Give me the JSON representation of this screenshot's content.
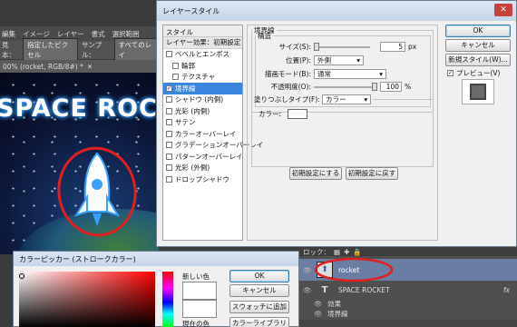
{
  "ps": {
    "menu": [
      "編集",
      "イメージ",
      "レイヤー",
      "書式",
      "選択範囲"
    ],
    "options": {
      "sample_label": "サンプル：",
      "sample_value": "指定したピクセル",
      "sample2_value": "すべてのレイ",
      "label0": "見本："
    },
    "doc_tab": "00% (rocket, RGB/8#) *",
    "canvas_title": "SPACE ROCK"
  },
  "layer_style": {
    "title": "レイヤースタイル",
    "close": "✕",
    "list_header": "スタイル",
    "list_subheader": "レイヤー効果：初期設定",
    "items": [
      {
        "label": "ベベルとエンボス",
        "checked": false,
        "sub": false,
        "selected": false
      },
      {
        "label": "輪郭",
        "checked": false,
        "sub": true,
        "selected": false
      },
      {
        "label": "テクスチャ",
        "checked": false,
        "sub": true,
        "selected": false
      },
      {
        "label": "境界線",
        "checked": true,
        "sub": false,
        "selected": true
      },
      {
        "label": "シャドウ (内側)",
        "checked": false,
        "sub": false,
        "selected": false
      },
      {
        "label": "光彩 (内側)",
        "checked": false,
        "sub": false,
        "selected": false
      },
      {
        "label": "サテン",
        "checked": false,
        "sub": false,
        "selected": false
      },
      {
        "label": "カラーオーバーレイ",
        "checked": false,
        "sub": false,
        "selected": false
      },
      {
        "label": "グラデーションオーバーレイ",
        "checked": false,
        "sub": false,
        "selected": false
      },
      {
        "label": "パターンオーバーレイ",
        "checked": false,
        "sub": false,
        "selected": false
      },
      {
        "label": "光彩 (外側)",
        "checked": false,
        "sub": false,
        "selected": false
      },
      {
        "label": "ドロップシャドウ",
        "checked": false,
        "sub": false,
        "selected": false
      }
    ],
    "panel": {
      "group_title": "境界線",
      "structure_title": "構造",
      "size_label": "サイズ(S):",
      "size_value": "5",
      "size_unit": "px",
      "position_label": "位置(P):",
      "position_value": "外側",
      "blend_label": "描画モード(B):",
      "blend_value": "通常",
      "opacity_label": "不透明度(O):",
      "opacity_value": "100",
      "opacity_unit": "%",
      "fill_type_label": "塗りつぶしタイプ(F):",
      "fill_type_value": "カラー",
      "color_label": "カラー:",
      "reset_default": "初期設定にする",
      "restore_default": "初期設定に戻す"
    },
    "buttons": {
      "ok": "OK",
      "cancel": "キャンセル",
      "new_style": "新規スタイル(W)...",
      "preview": "プレビュー(V)"
    }
  },
  "color_picker": {
    "title": "カラーピッカー (ストロークカラー)",
    "new_label": "新しい色",
    "current_label": "現在の色",
    "ok": "OK",
    "cancel": "キャンセル",
    "add_swatch": "スウォッチに追加",
    "color_library": "カラーライブラリ"
  },
  "layers": {
    "lock_label": "ロック：",
    "rows": [
      {
        "name": "rocket",
        "kind": "smart"
      },
      {
        "name": "SPACE ROCKET",
        "kind": "text",
        "fx": "fx"
      },
      {
        "name": "効果",
        "kind": "effect"
      },
      {
        "name": "境界線",
        "kind": "effect-item"
      }
    ]
  },
  "colors": {
    "selection": "#3a86de",
    "annotation": "#e02020"
  }
}
